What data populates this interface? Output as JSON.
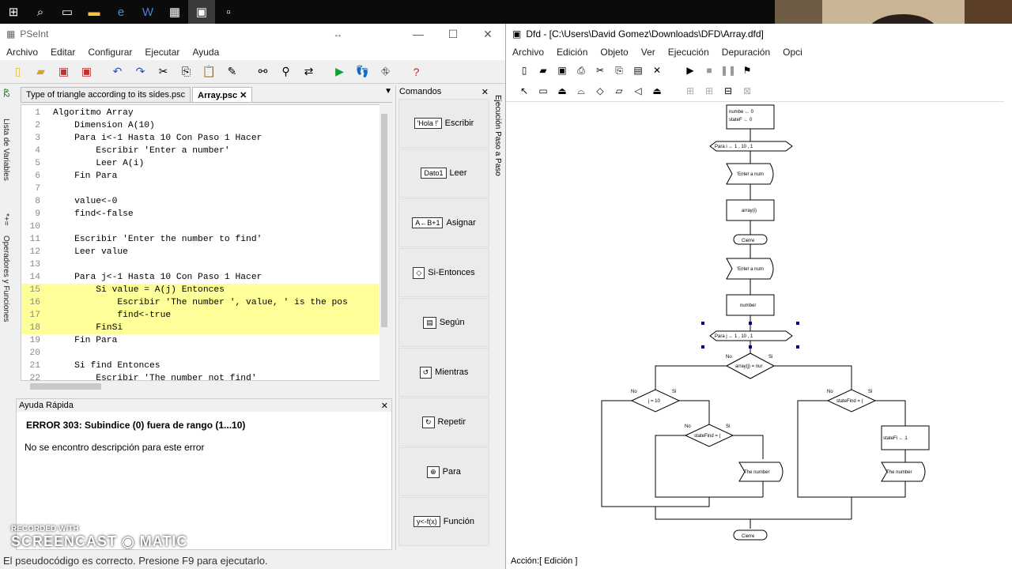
{
  "taskbar": {
    "icons": [
      "windows-icon",
      "search-icon",
      "task-view-icon",
      "folder-icon",
      "edge-icon",
      "word-icon",
      "tablet-icon",
      "pseint-icon",
      "dfd-icon"
    ]
  },
  "pseint": {
    "title": "PSeInt",
    "menu": [
      "Archivo",
      "Editar",
      "Configurar",
      "Ejecutar",
      "Ayuda"
    ],
    "side_tabs": [
      "Lista de Variables",
      "Operadores y Funciones"
    ],
    "doc_tabs": [
      "Type of triangle according to its sides.psc",
      "Array.psc"
    ],
    "code": [
      {
        "n": "1",
        "text": "Algoritmo Array"
      },
      {
        "n": "2",
        "text": "    Dimension A(10)"
      },
      {
        "n": "3",
        "text": "    Para i<-1 Hasta 10 Con Paso 1 Hacer"
      },
      {
        "n": "4",
        "text": "        Escribir 'Enter a number'"
      },
      {
        "n": "5",
        "text": "        Leer A(i)"
      },
      {
        "n": "6",
        "text": "    Fin Para"
      },
      {
        "n": "7",
        "text": ""
      },
      {
        "n": "8",
        "text": "    value<-0"
      },
      {
        "n": "9",
        "text": "    find<-false"
      },
      {
        "n": "10",
        "text": ""
      },
      {
        "n": "11",
        "text": "    Escribir 'Enter the number to find'"
      },
      {
        "n": "12",
        "text": "    Leer value"
      },
      {
        "n": "13",
        "text": ""
      },
      {
        "n": "14",
        "text": "    Para j<-1 Hasta 10 Con Paso 1 Hacer"
      },
      {
        "n": "15",
        "text": "        Si value = A(j) Entonces"
      },
      {
        "n": "16",
        "text": "            Escribir 'The number ', value, ' is the pos"
      },
      {
        "n": "17",
        "text": "            find<-true"
      },
      {
        "n": "18",
        "text": "        FinSi"
      },
      {
        "n": "19",
        "text": "    Fin Para"
      },
      {
        "n": "20",
        "text": ""
      },
      {
        "n": "21",
        "text": "    Si find Entonces"
      },
      {
        "n": "22",
        "text": "        Escribir 'The number not find'"
      }
    ],
    "commands_title": "Comandos",
    "commands": [
      {
        "icon": "'Hola !'",
        "label": "Escribir"
      },
      {
        "icon": "Dato1",
        "label": "Leer"
      },
      {
        "icon": "A←B+1",
        "label": "Asignar"
      },
      {
        "icon": "◇",
        "label": "Si-Entonces"
      },
      {
        "icon": "▤",
        "label": "Según"
      },
      {
        "icon": "↺",
        "label": "Mientras"
      },
      {
        "icon": "↻",
        "label": "Repetir"
      },
      {
        "icon": "⊕",
        "label": "Para"
      },
      {
        "icon": "y<-f(x)",
        "label": "Función"
      }
    ],
    "exec_tab": "Ejecución Paso a Paso",
    "help_title": "Ayuda Rápida",
    "help_error": "ERROR 303: Subindice (0) fuera de rango (1...10)",
    "help_desc": "No se encontro descripción para este error",
    "status": "El pseudocódigo es correcto. Presione F9 para ejecutarlo.",
    "watermark_1": "RECORDED WITH",
    "watermark_2": "SCREENCAST ◉ MATIC"
  },
  "dfd": {
    "title": "Dfd - [C:\\Users\\David Gomez\\Downloads\\DFD\\Array.dfd]",
    "menu": [
      "Archivo",
      "Edición",
      "Objeto",
      "Ver",
      "Ejecución",
      "Depuración",
      "Opci"
    ],
    "status": "Acción:[ Edición ]",
    "flow": {
      "assign1": "numbe ← 0",
      "assign2": "stateF ← 0",
      "loop1": "Para  i  ←  1 , 10 , 1",
      "out1": "'Enter a num",
      "in1": "array(i)",
      "close1": "Cierre",
      "out2": "'Enter a num",
      "in2": "number",
      "loop2": "Para  j  ←  1 , 10 , 1",
      "cond1": "array(j) = nur",
      "no": "No",
      "si": "Si",
      "cond2": "j = 10",
      "cond3": "stateFind = (",
      "cond4": "stateFind = (",
      "assign3": "stateFi ← 1",
      "out3": "'The number",
      "out4": "'The number",
      "close2": "Cierre"
    }
  }
}
